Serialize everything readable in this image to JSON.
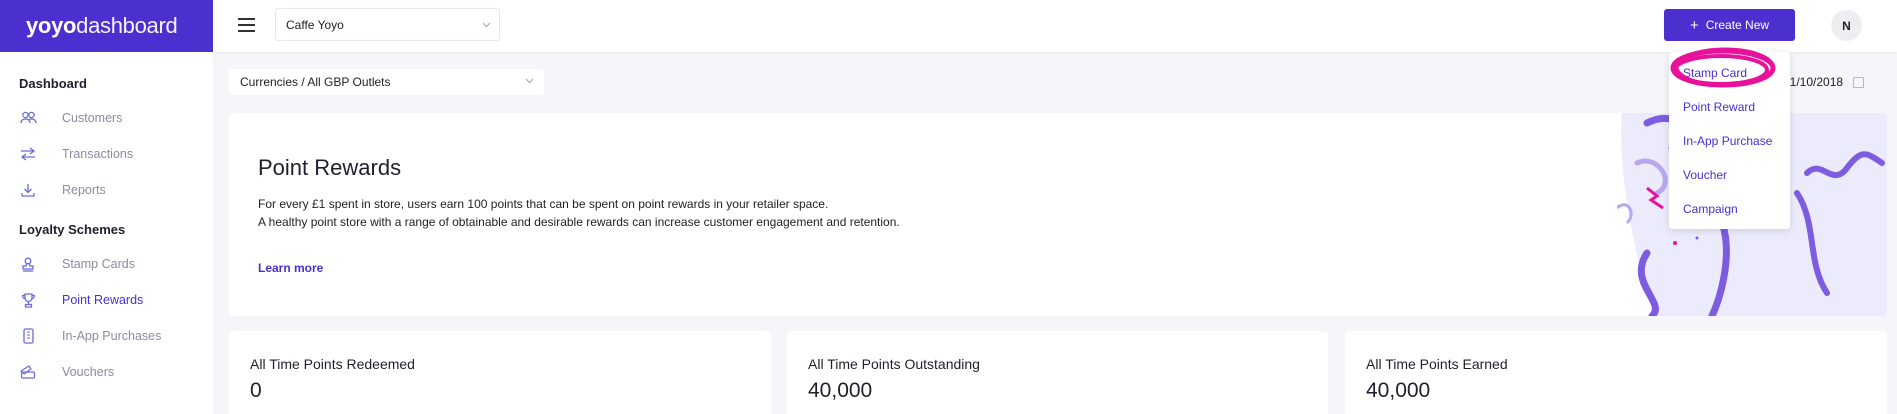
{
  "app": {
    "logo_brand": "yoyo",
    "logo_rest": "dashboard"
  },
  "sidebar": {
    "section_dashboard": "Dashboard",
    "dashboard_items": [
      {
        "label": "Customers",
        "icon": "users-icon"
      },
      {
        "label": "Transactions",
        "icon": "transfer-arrows-icon"
      },
      {
        "label": "Reports",
        "icon": "download-icon"
      }
    ],
    "section_loyalty": "Loyalty Schemes",
    "loyalty_items": [
      {
        "label": "Stamp Cards",
        "icon": "stamp-icon"
      },
      {
        "label": "Point Rewards",
        "icon": "trophy-icon",
        "active": true
      },
      {
        "label": "In-App Purchases",
        "icon": "phone-icon"
      },
      {
        "label": "Vouchers",
        "icon": "ticket-icon"
      }
    ]
  },
  "header": {
    "org_select": "Caffe Yoyo",
    "create_button": "Create New",
    "avatar_initial": "N"
  },
  "filters": {
    "currency_select": "Currencies / All GBP Outlets",
    "date_value": "01/10/2018"
  },
  "create_menu": {
    "items": [
      "Stamp Card",
      "Point Reward",
      "In-App Purchase",
      "Voucher",
      "Campaign"
    ]
  },
  "hero": {
    "title": "Point Rewards",
    "line1": "For every £1 spent in store, users earn 100 points that can be spent on point rewards in your retailer space.",
    "line2": "A healthy point store with a range of obtainable and desirable rewards can increase customer engagement and retention.",
    "learn_more": "Learn more"
  },
  "stats": [
    {
      "title": "All Time Points Redeemed",
      "value": "0"
    },
    {
      "title": "All Time Points Outstanding",
      "value": "40,000"
    },
    {
      "title": "All Time Points Earned",
      "value": "40,000"
    }
  ],
  "colors": {
    "accent": "#4b2fcf",
    "highlight": "#e8119a",
    "background": "#f5f5fa"
  }
}
